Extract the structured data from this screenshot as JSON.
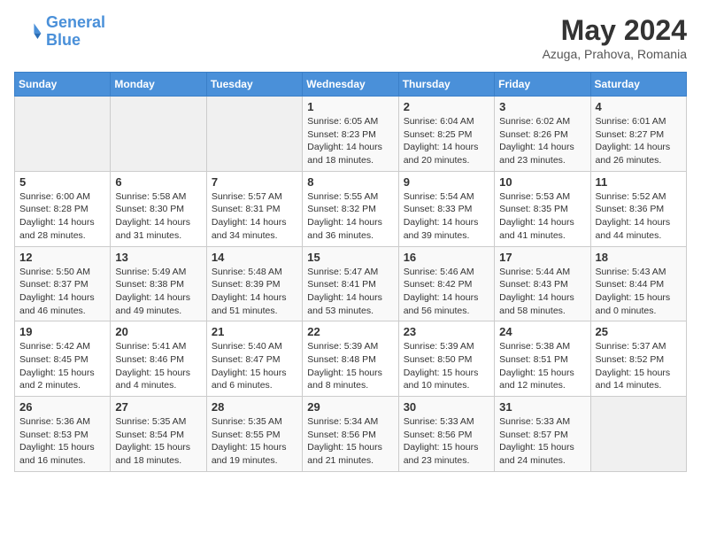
{
  "header": {
    "logo_general": "General",
    "logo_blue": "Blue",
    "month_title": "May 2024",
    "location": "Azuga, Prahova, Romania"
  },
  "days_of_week": [
    "Sunday",
    "Monday",
    "Tuesday",
    "Wednesday",
    "Thursday",
    "Friday",
    "Saturday"
  ],
  "weeks": [
    [
      {
        "day": "",
        "info": ""
      },
      {
        "day": "",
        "info": ""
      },
      {
        "day": "",
        "info": ""
      },
      {
        "day": "1",
        "info": "Sunrise: 6:05 AM\nSunset: 8:23 PM\nDaylight: 14 hours\nand 18 minutes."
      },
      {
        "day": "2",
        "info": "Sunrise: 6:04 AM\nSunset: 8:25 PM\nDaylight: 14 hours\nand 20 minutes."
      },
      {
        "day": "3",
        "info": "Sunrise: 6:02 AM\nSunset: 8:26 PM\nDaylight: 14 hours\nand 23 minutes."
      },
      {
        "day": "4",
        "info": "Sunrise: 6:01 AM\nSunset: 8:27 PM\nDaylight: 14 hours\nand 26 minutes."
      }
    ],
    [
      {
        "day": "5",
        "info": "Sunrise: 6:00 AM\nSunset: 8:28 PM\nDaylight: 14 hours\nand 28 minutes."
      },
      {
        "day": "6",
        "info": "Sunrise: 5:58 AM\nSunset: 8:30 PM\nDaylight: 14 hours\nand 31 minutes."
      },
      {
        "day": "7",
        "info": "Sunrise: 5:57 AM\nSunset: 8:31 PM\nDaylight: 14 hours\nand 34 minutes."
      },
      {
        "day": "8",
        "info": "Sunrise: 5:55 AM\nSunset: 8:32 PM\nDaylight: 14 hours\nand 36 minutes."
      },
      {
        "day": "9",
        "info": "Sunrise: 5:54 AM\nSunset: 8:33 PM\nDaylight: 14 hours\nand 39 minutes."
      },
      {
        "day": "10",
        "info": "Sunrise: 5:53 AM\nSunset: 8:35 PM\nDaylight: 14 hours\nand 41 minutes."
      },
      {
        "day": "11",
        "info": "Sunrise: 5:52 AM\nSunset: 8:36 PM\nDaylight: 14 hours\nand 44 minutes."
      }
    ],
    [
      {
        "day": "12",
        "info": "Sunrise: 5:50 AM\nSunset: 8:37 PM\nDaylight: 14 hours\nand 46 minutes."
      },
      {
        "day": "13",
        "info": "Sunrise: 5:49 AM\nSunset: 8:38 PM\nDaylight: 14 hours\nand 49 minutes."
      },
      {
        "day": "14",
        "info": "Sunrise: 5:48 AM\nSunset: 8:39 PM\nDaylight: 14 hours\nand 51 minutes."
      },
      {
        "day": "15",
        "info": "Sunrise: 5:47 AM\nSunset: 8:41 PM\nDaylight: 14 hours\nand 53 minutes."
      },
      {
        "day": "16",
        "info": "Sunrise: 5:46 AM\nSunset: 8:42 PM\nDaylight: 14 hours\nand 56 minutes."
      },
      {
        "day": "17",
        "info": "Sunrise: 5:44 AM\nSunset: 8:43 PM\nDaylight: 14 hours\nand 58 minutes."
      },
      {
        "day": "18",
        "info": "Sunrise: 5:43 AM\nSunset: 8:44 PM\nDaylight: 15 hours\nand 0 minutes."
      }
    ],
    [
      {
        "day": "19",
        "info": "Sunrise: 5:42 AM\nSunset: 8:45 PM\nDaylight: 15 hours\nand 2 minutes."
      },
      {
        "day": "20",
        "info": "Sunrise: 5:41 AM\nSunset: 8:46 PM\nDaylight: 15 hours\nand 4 minutes."
      },
      {
        "day": "21",
        "info": "Sunrise: 5:40 AM\nSunset: 8:47 PM\nDaylight: 15 hours\nand 6 minutes."
      },
      {
        "day": "22",
        "info": "Sunrise: 5:39 AM\nSunset: 8:48 PM\nDaylight: 15 hours\nand 8 minutes."
      },
      {
        "day": "23",
        "info": "Sunrise: 5:39 AM\nSunset: 8:50 PM\nDaylight: 15 hours\nand 10 minutes."
      },
      {
        "day": "24",
        "info": "Sunrise: 5:38 AM\nSunset: 8:51 PM\nDaylight: 15 hours\nand 12 minutes."
      },
      {
        "day": "25",
        "info": "Sunrise: 5:37 AM\nSunset: 8:52 PM\nDaylight: 15 hours\nand 14 minutes."
      }
    ],
    [
      {
        "day": "26",
        "info": "Sunrise: 5:36 AM\nSunset: 8:53 PM\nDaylight: 15 hours\nand 16 minutes."
      },
      {
        "day": "27",
        "info": "Sunrise: 5:35 AM\nSunset: 8:54 PM\nDaylight: 15 hours\nand 18 minutes."
      },
      {
        "day": "28",
        "info": "Sunrise: 5:35 AM\nSunset: 8:55 PM\nDaylight: 15 hours\nand 19 minutes."
      },
      {
        "day": "29",
        "info": "Sunrise: 5:34 AM\nSunset: 8:56 PM\nDaylight: 15 hours\nand 21 minutes."
      },
      {
        "day": "30",
        "info": "Sunrise: 5:33 AM\nSunset: 8:56 PM\nDaylight: 15 hours\nand 23 minutes."
      },
      {
        "day": "31",
        "info": "Sunrise: 5:33 AM\nSunset: 8:57 PM\nDaylight: 15 hours\nand 24 minutes."
      },
      {
        "day": "",
        "info": ""
      }
    ]
  ]
}
